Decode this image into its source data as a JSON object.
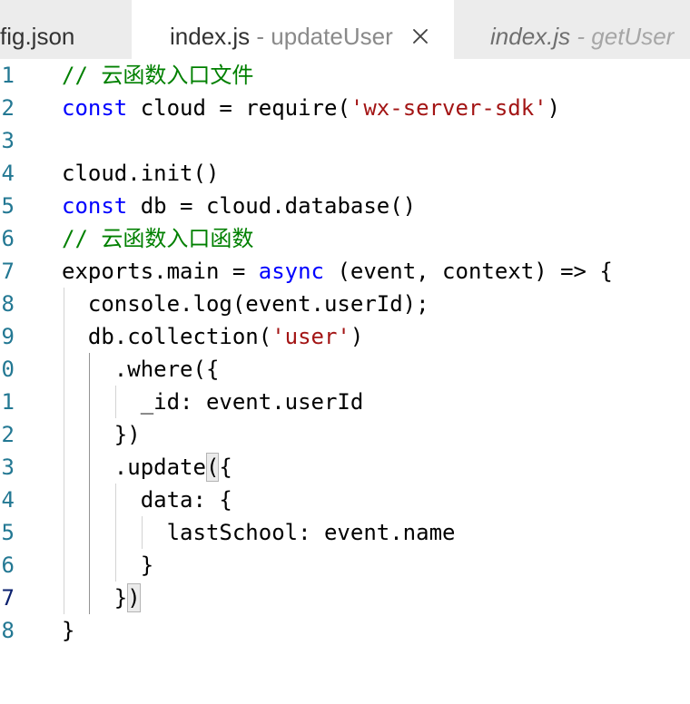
{
  "tabs": [
    {
      "label": "fig.json",
      "active": false,
      "preview": false
    },
    {
      "label": "index.js",
      "description": "- updateUser",
      "active": true,
      "preview": false,
      "close_icon": "close-icon"
    },
    {
      "label": "index.js",
      "description": "- getUser",
      "active": false,
      "preview": true
    }
  ],
  "editor": {
    "line_number_color": "#237893",
    "active_line_number_color": "#0b216f",
    "lines": [
      {
        "number": "1",
        "tokens": [
          {
            "text": "// 云函数入口文件",
            "color": "#008000"
          }
        ]
      },
      {
        "number": "2",
        "tokens": [
          {
            "text": "const",
            "color": "#0000ff"
          },
          {
            "text": " cloud = require("
          },
          {
            "text": "'wx-server-sdk'",
            "color": "#a31515"
          },
          {
            "text": ")"
          }
        ]
      },
      {
        "number": "3",
        "tokens": []
      },
      {
        "number": "4",
        "tokens": [
          {
            "text": "cloud.init()"
          }
        ]
      },
      {
        "number": "5",
        "tokens": [
          {
            "text": "const",
            "color": "#0000ff"
          },
          {
            "text": " db = cloud.database()"
          }
        ]
      },
      {
        "number": "6",
        "tokens": [
          {
            "text": "// 云函数入口函数",
            "color": "#008000"
          }
        ]
      },
      {
        "number": "7",
        "tokens": [
          {
            "text": "exports.main = "
          },
          {
            "text": "async",
            "color": "#0000ff"
          },
          {
            "text": " (event, context) => {"
          }
        ]
      },
      {
        "number": "8",
        "tokens": [
          {
            "text": "  console.log(event.userId);"
          }
        ]
      },
      {
        "number": "9",
        "tokens": [
          {
            "text": "  db.collection("
          },
          {
            "text": "'user'",
            "color": "#a31515"
          },
          {
            "text": ")"
          }
        ]
      },
      {
        "number": "0",
        "tokens": [
          {
            "text": "    .where({"
          }
        ]
      },
      {
        "number": "1",
        "tokens": [
          {
            "text": "      _id: event.userId"
          }
        ]
      },
      {
        "number": "2",
        "tokens": [
          {
            "text": "    })"
          }
        ]
      },
      {
        "number": "3",
        "tokens": [
          {
            "text": "    .update"
          },
          {
            "text": "(",
            "bracket_match": true
          },
          {
            "text": "{"
          }
        ]
      },
      {
        "number": "4",
        "tokens": [
          {
            "text": "      data: {"
          }
        ]
      },
      {
        "number": "5",
        "tokens": [
          {
            "text": "        lastSchool: event.name"
          }
        ]
      },
      {
        "number": "6",
        "tokens": [
          {
            "text": "      }"
          }
        ]
      },
      {
        "number": "7",
        "active": true,
        "tokens": [
          {
            "text": "    }"
          },
          {
            "text": ")",
            "bracket_match": true
          }
        ]
      },
      {
        "number": "8",
        "tokens": [
          {
            "text": "}"
          }
        ]
      }
    ]
  }
}
